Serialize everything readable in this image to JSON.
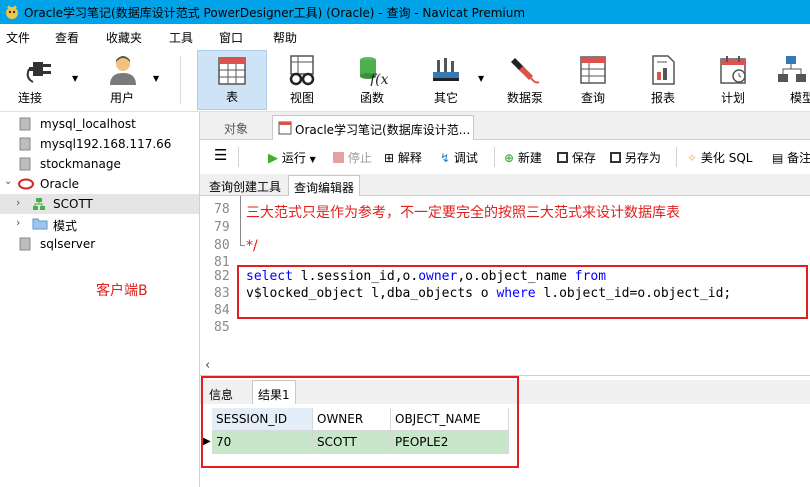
{
  "window": {
    "title": "Oracle学习笔记(数据库设计范式 PowerDesigner工具) (Oracle) - 查询 - Navicat Premium"
  },
  "menu": [
    "文件",
    "查看",
    "收藏夹",
    "工具",
    "窗口",
    "帮助"
  ],
  "toolbar": {
    "items": [
      {
        "label": "连接",
        "icon": "plug-icon"
      },
      {
        "label": "用户",
        "icon": "user-icon"
      },
      {
        "label": "表",
        "icon": "table-icon"
      },
      {
        "label": "视图",
        "icon": "view-icon"
      },
      {
        "label": "函数",
        "icon": "function-icon"
      },
      {
        "label": "其它",
        "icon": "tools-icon"
      },
      {
        "label": "数据泵",
        "icon": "pump-icon"
      },
      {
        "label": "查询",
        "icon": "query-icon"
      },
      {
        "label": "报表",
        "icon": "report-icon"
      },
      {
        "label": "计划",
        "icon": "calendar-icon"
      },
      {
        "label": "模型",
        "icon": "model-icon"
      }
    ]
  },
  "sidebar": {
    "items": [
      {
        "label": "mysql_localhost"
      },
      {
        "label": "mysql192.168.117.66"
      },
      {
        "label": "stockmanage"
      },
      {
        "label": "Oracle"
      },
      {
        "label": "SCOTT"
      },
      {
        "label": "模式"
      },
      {
        "label": "sqlserver"
      }
    ],
    "annotation": "客户端B"
  },
  "tabs": {
    "objects": "对象",
    "query_tab": "Oracle学习笔记(数据库设计范..."
  },
  "query_toolbar": {
    "run": "运行",
    "stop": "停止",
    "explain": "解释",
    "debug": "调试",
    "new": "新建",
    "save": "保存",
    "save_as": "另存为",
    "beautify": "美化 SQL",
    "notes": "备注"
  },
  "editor_tabs": {
    "builder": "查询创建工具",
    "editor": "查询编辑器"
  },
  "editor": {
    "lines": [
      {
        "num": "78",
        "text": "三大范式只是作为参考，不一定要完全的按照三大范式来设计数据库表"
      },
      {
        "num": "79",
        "text": ""
      },
      {
        "num": "80",
        "text": "*/"
      },
      {
        "num": "81",
        "text": ""
      },
      {
        "num": "82",
        "text": ""
      },
      {
        "num": "83",
        "text": ""
      },
      {
        "num": "84",
        "text": ""
      },
      {
        "num": "85",
        "text": ""
      }
    ],
    "sql_line1": {
      "kw1": "select",
      "t1": " l.session_id,o.",
      "kw2": "owner",
      "t2": ",o.object_name ",
      "kw3": "from"
    },
    "sql_line2": {
      "t1": "v$locked_object l,dba_objects o ",
      "kw1": "where",
      "t2": " l.object_id=o.object_id;"
    }
  },
  "result": {
    "tabs": [
      "信息",
      "结果1"
    ],
    "columns": [
      "SESSION_ID",
      "OWNER",
      "OBJECT_NAME"
    ],
    "rows": [
      [
        "70",
        "SCOTT",
        "PEOPLE2"
      ]
    ]
  },
  "colors": {
    "titlebar": "#00a2e8",
    "highlight_box": "#e0201e",
    "keyword": "#0000ff",
    "row_selected": "#c8e6c9"
  }
}
